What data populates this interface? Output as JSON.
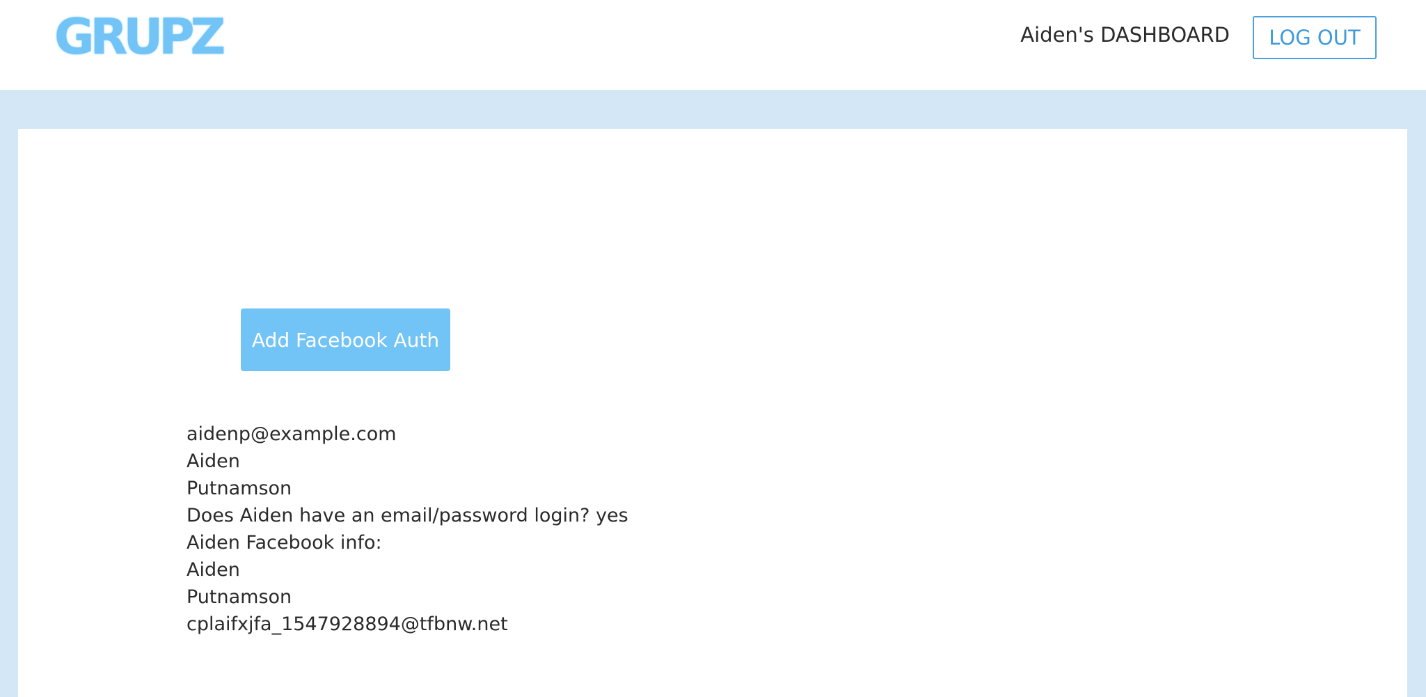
{
  "header": {
    "logo": "GRUPZ",
    "dashboard_title": "Aiden's DASHBOARD",
    "logout_label": "LOG OUT"
  },
  "main": {
    "facebook_button_label": "Add Facebook Auth",
    "user_info": [
      "aidenp@example.com",
      "Aiden",
      "Putnamson",
      "Does Aiden have an email/password login? yes",
      "Aiden Facebook info:",
      "Aiden",
      "Putnamson",
      "cplaifxjfa_1547928894@tfbnw.net"
    ]
  },
  "colors": {
    "background": "#d3e7f6",
    "accent": "#72c3f6",
    "logout_border": "#4aa1dc"
  }
}
